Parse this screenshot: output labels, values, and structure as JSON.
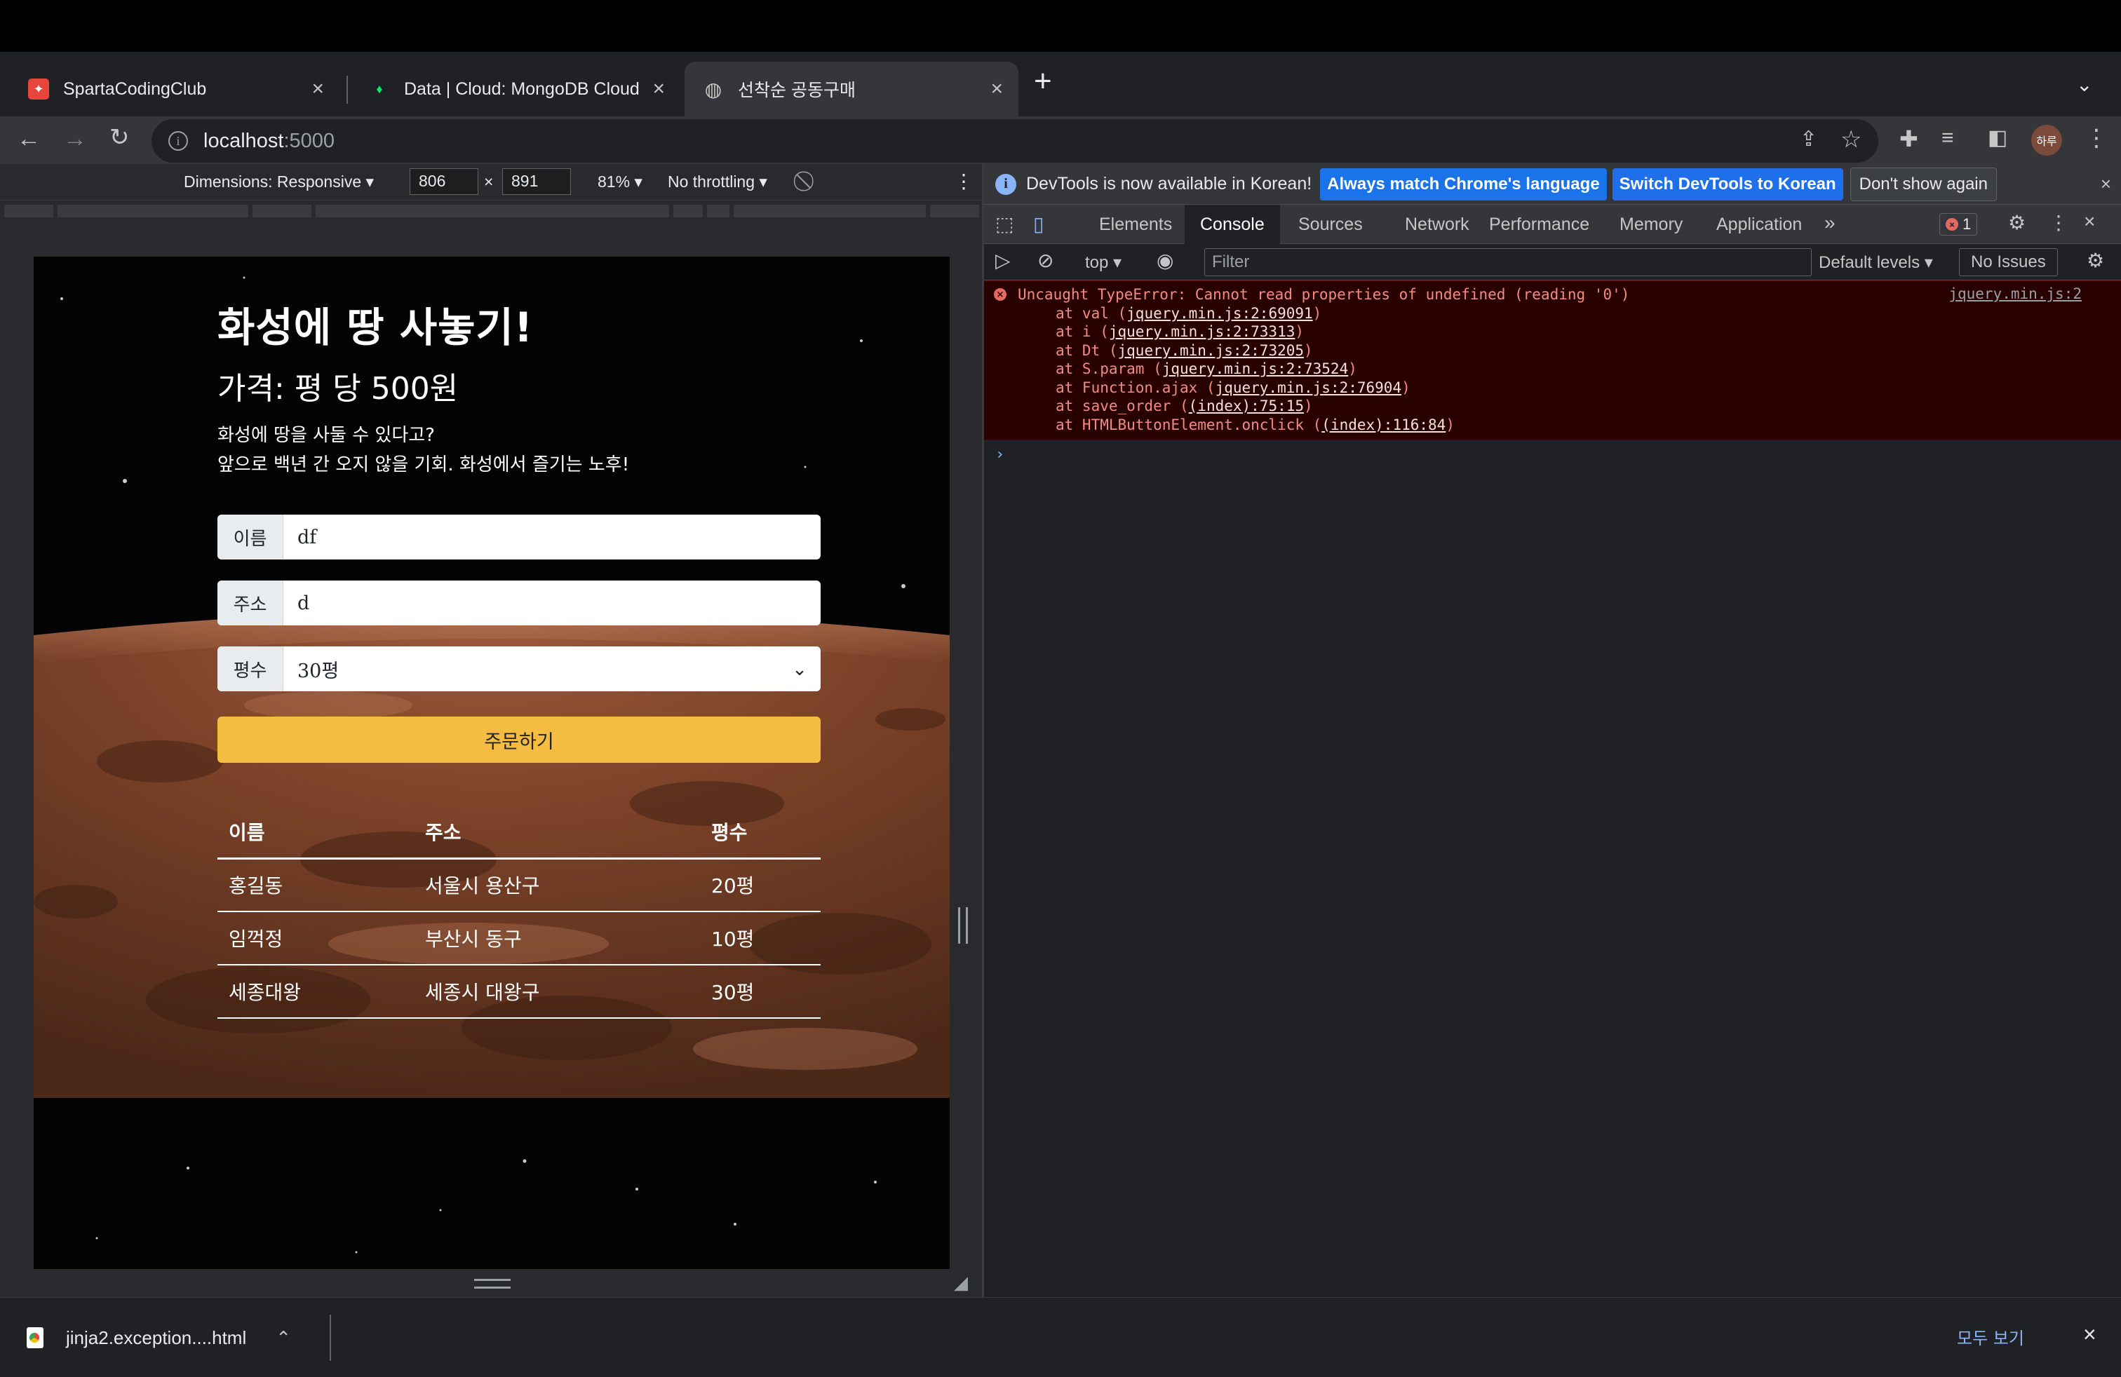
{
  "browser": {
    "tabs": [
      {
        "title": "SpartaCodingClub",
        "active": false,
        "favicon": "sparta-favicon",
        "favicon_color": "#e8453c"
      },
      {
        "title": "Data | Cloud: MongoDB Cloud",
        "active": false,
        "favicon": "mongodb-leaf-icon",
        "favicon_color": "#00ed64"
      },
      {
        "title": "선착순 공동구매",
        "active": true,
        "favicon": "globe-icon"
      }
    ],
    "url_host": "localhost",
    "url_port": ":5000",
    "profile_label": "하루"
  },
  "device_toolbar": {
    "dimensions_label": "Dimensions: Responsive",
    "width": "806",
    "height": "891",
    "times": "×",
    "zoom": "81%",
    "throttling": "No throttling"
  },
  "page": {
    "title": "화성에 땅 사놓기!",
    "subtitle": "가격: 평 당 500원",
    "desc_line1": "화성에 땅을 사둘 수 있다고?",
    "desc_line2": "앞으로 백년 간 오지 않을 기회. 화성에서 즐기는 노후!",
    "form": {
      "name_label": "이름",
      "name_value": "df",
      "address_label": "주소",
      "address_value": "d",
      "size_label": "평수",
      "size_value": "30평"
    },
    "order_button": "주문하기",
    "table": {
      "headers": [
        "이름",
        "주소",
        "평수"
      ],
      "rows": [
        [
          "홍길동",
          "서울시 용산구",
          "20평"
        ],
        [
          "임꺽정",
          "부산시 동구",
          "10평"
        ],
        [
          "세종대왕",
          "세종시 대왕구",
          "30평"
        ]
      ]
    }
  },
  "devtools": {
    "infobar_text": "DevTools is now available in Korean!",
    "btn_match_language": "Always match Chrome's language",
    "btn_switch_korean": "Switch DevTools to Korean",
    "btn_dont_show": "Don't show again",
    "tabs": [
      "Elements",
      "Console",
      "Sources",
      "Network",
      "Performance",
      "Memory",
      "Application"
    ],
    "active_tab": "Console",
    "error_count": "1",
    "context": "top",
    "filter_placeholder": "Filter",
    "levels": "Default levels",
    "issues": "No Issues",
    "error": {
      "message": "Uncaught TypeError: Cannot read properties of undefined (reading '0')",
      "source": "jquery.min.js:2",
      "stack": [
        {
          "fn": "at val (",
          "loc": "jquery.min.js:2:69091",
          "end": ")"
        },
        {
          "fn": "at i (",
          "loc": "jquery.min.js:2:73313",
          "end": ")"
        },
        {
          "fn": "at Dt (",
          "loc": "jquery.min.js:2:73205",
          "end": ")"
        },
        {
          "fn": "at S.param (",
          "loc": "jquery.min.js:2:73524",
          "end": ")"
        },
        {
          "fn": "at Function.ajax (",
          "loc": "jquery.min.js:2:76904",
          "end": ")"
        },
        {
          "fn": "at save_order (",
          "loc": "(index):75:15",
          "end": ")"
        },
        {
          "fn": "at HTMLButtonElement.onclick (",
          "loc": "(index):116:84",
          "end": ")"
        }
      ]
    },
    "prompt": "›"
  },
  "downloads": {
    "file_name": "jinja2.exception....html",
    "show_all": "모두 보기"
  },
  "colors": {
    "order_button": "#f5bc42",
    "devtools_blue": "#1a73e8",
    "error_red": "#f28b82"
  }
}
